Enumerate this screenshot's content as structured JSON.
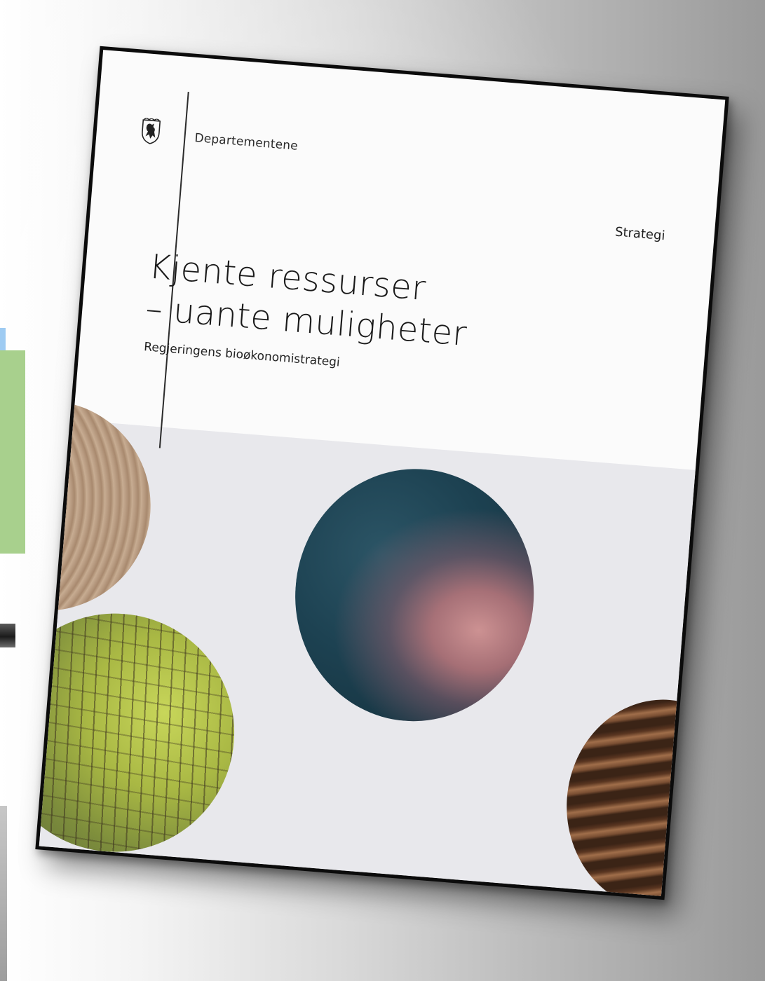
{
  "document": {
    "department": "Departementene",
    "type": "Strategi",
    "title_line1": "Kjente ressurser",
    "title_line2": "– uante muligheter",
    "subtitle": "Regjeringens bioøkonomistrategi",
    "logo_icon": "norwegian-coat-of-arms-icon"
  },
  "images": [
    {
      "name": "wood-cross-section",
      "color": "#b69a7e"
    },
    {
      "name": "tree-bark-lichen",
      "color": "#a9b844"
    },
    {
      "name": "ocean-plankton",
      "color": "#1d4252"
    },
    {
      "name": "plowed-soil",
      "color": "#5a3621"
    }
  ]
}
